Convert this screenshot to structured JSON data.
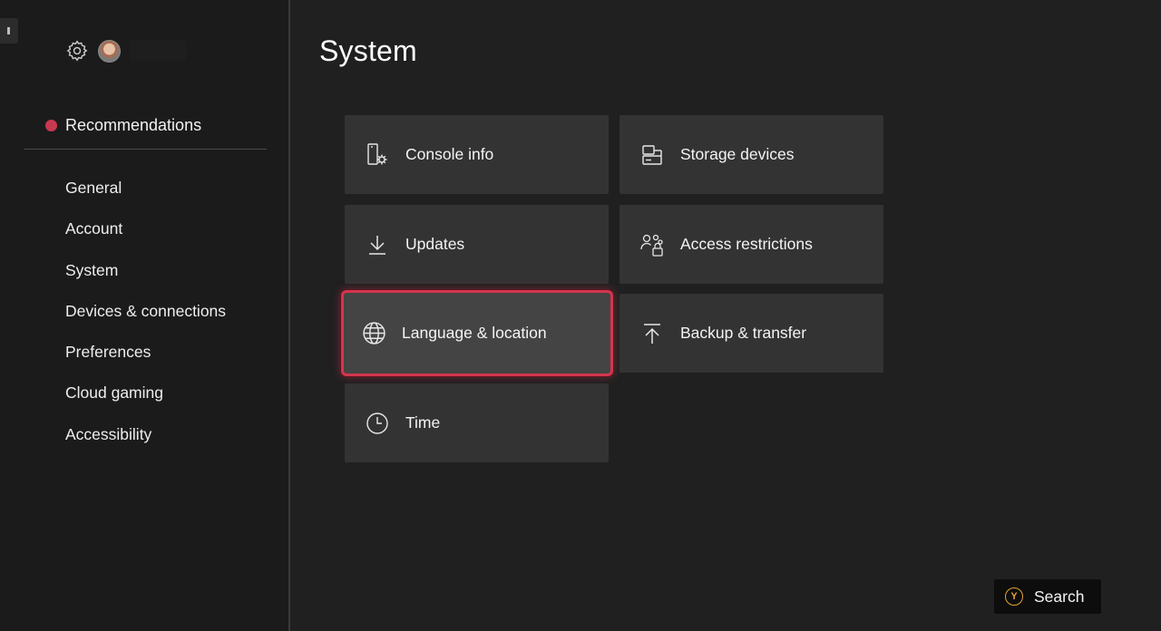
{
  "sidebar": {
    "recommendations_label": "Recommendations",
    "items": [
      {
        "label": "General"
      },
      {
        "label": "Account"
      },
      {
        "label": "System"
      },
      {
        "label": "Devices & connections"
      },
      {
        "label": "Preferences"
      },
      {
        "label": "Cloud gaming"
      },
      {
        "label": "Accessibility"
      }
    ]
  },
  "main": {
    "title": "System",
    "tiles": [
      {
        "label": "Console info",
        "icon": "console-info-icon"
      },
      {
        "label": "Storage devices",
        "icon": "storage-icon"
      },
      {
        "label": "Updates",
        "icon": "download-icon"
      },
      {
        "label": "Access restrictions",
        "icon": "access-restrictions-icon"
      },
      {
        "label": "Language & location",
        "icon": "globe-icon",
        "focused": true
      },
      {
        "label": "Backup & transfer",
        "icon": "upload-icon"
      },
      {
        "label": "Time",
        "icon": "clock-icon"
      }
    ]
  },
  "footer": {
    "search_label": "Search",
    "search_button_glyph": "Y"
  },
  "colors": {
    "accent_focus": "#d4354e",
    "recommendation_dot": "#c8384f",
    "y_button": "#e5a136"
  }
}
